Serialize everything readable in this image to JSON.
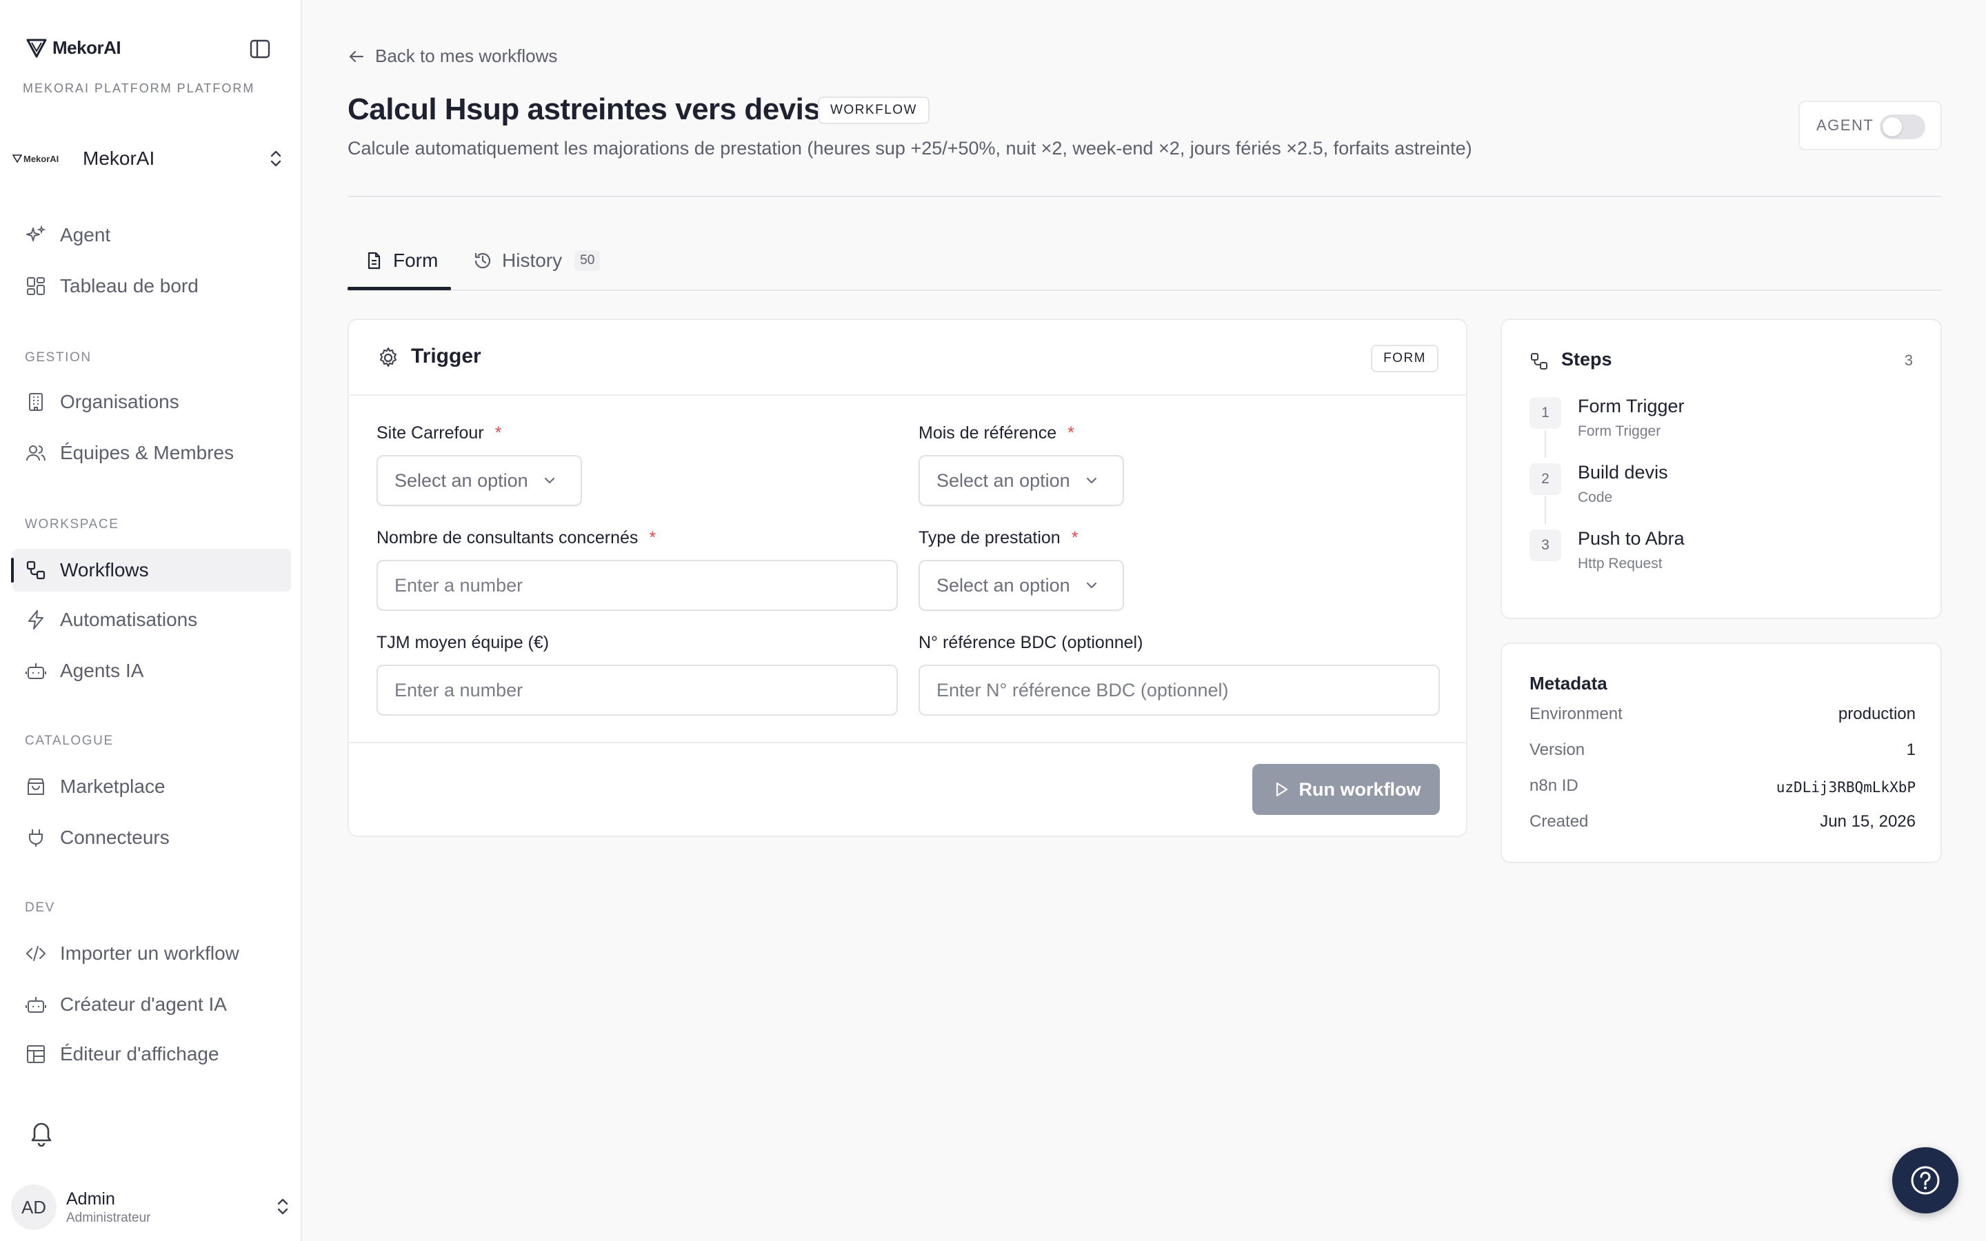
{
  "sidebar": {
    "logo_text": "MekorAI",
    "platform_label": "MEKORAI PLATFORM PLATFORM",
    "org": {
      "mini_logo": "MekorAI",
      "name": "MekorAI"
    },
    "items": [
      {
        "label": "Agent",
        "icon": "sparkles-icon"
      },
      {
        "label": "Tableau de bord",
        "icon": "dashboard-icon"
      }
    ],
    "sections": {
      "gestion": {
        "title": "GESTION",
        "items": [
          {
            "label": "Organisations",
            "icon": "building-icon"
          },
          {
            "label": "Équipes & Membres",
            "icon": "users-icon"
          }
        ]
      },
      "workspace": {
        "title": "WORKSPACE",
        "items": [
          {
            "label": "Workflows",
            "icon": "workflow-icon"
          },
          {
            "label": "Automatisations",
            "icon": "bolt-icon"
          },
          {
            "label": "Agents IA",
            "icon": "bot-icon"
          }
        ]
      },
      "catalogue": {
        "title": "CATALOGUE",
        "items": [
          {
            "label": "Marketplace",
            "icon": "store-icon"
          },
          {
            "label": "Connecteurs",
            "icon": "plug-icon"
          }
        ]
      },
      "dev": {
        "title": "DEV",
        "items": [
          {
            "label": "Importer un workflow",
            "icon": "code-icon"
          },
          {
            "label": "Créateur d'agent IA",
            "icon": "bot-icon"
          },
          {
            "label": "Éditeur d'affichage",
            "icon": "layout-icon"
          }
        ]
      }
    },
    "active_item": "Workflows",
    "user": {
      "initials": "AD",
      "name": "Admin",
      "role": "Administrateur"
    }
  },
  "header": {
    "back_label": "Back to mes workflows",
    "title": "Calcul Hsup astreintes vers devis",
    "badge": "WORKFLOW",
    "description": "Calcule automatiquement les majorations de prestation (heures sup +25/+50%, nuit ×2, week-end ×2, jours fériés ×2.5, forfaits astreinte)",
    "agent_toggle": {
      "label": "AGENT",
      "on": false
    }
  },
  "tabs": [
    {
      "label": "Form",
      "icon": "document-icon",
      "active": true
    },
    {
      "label": "History",
      "icon": "history-icon",
      "count": "50",
      "active": false
    }
  ],
  "trigger": {
    "title": "Trigger",
    "badge": "FORM",
    "fields": {
      "site": {
        "label": "Site Carrefour",
        "required": "*",
        "placeholder": "Select an option"
      },
      "mois": {
        "label": "Mois de référence",
        "required": "*",
        "placeholder": "Select an option"
      },
      "consultants": {
        "label": "Nombre de consultants concernés",
        "required": "*",
        "placeholder": "Enter a number"
      },
      "type": {
        "label": "Type de prestation",
        "required": "*",
        "placeholder": "Select an option"
      },
      "tjm": {
        "label": "TJM moyen équipe (€)",
        "placeholder": "Enter a number"
      },
      "bdc": {
        "label": "N° référence BDC (optionnel)",
        "placeholder": "Enter N° référence BDC (optionnel)"
      }
    },
    "run_label": "Run workflow"
  },
  "steps": {
    "title": "Steps",
    "count": "3",
    "items": [
      {
        "num": "1",
        "title": "Form Trigger",
        "sub": "Form Trigger"
      },
      {
        "num": "2",
        "title": "Build devis",
        "sub": "Code"
      },
      {
        "num": "3",
        "title": "Push to Abra",
        "sub": "Http Request"
      }
    ]
  },
  "metadata": {
    "title": "Metadata",
    "rows": [
      {
        "key": "Environment",
        "value": "production"
      },
      {
        "key": "Version",
        "value": "1"
      },
      {
        "key": "n8n ID",
        "value": "uzDLij3RBQmLkXbP"
      },
      {
        "key": "Created",
        "value": "Jun 15, 2026"
      }
    ]
  },
  "colors": {
    "accent": "#1e2230",
    "run_button": "#9499a8",
    "help_button": "#1e2a4a",
    "required": "#e5484d"
  }
}
